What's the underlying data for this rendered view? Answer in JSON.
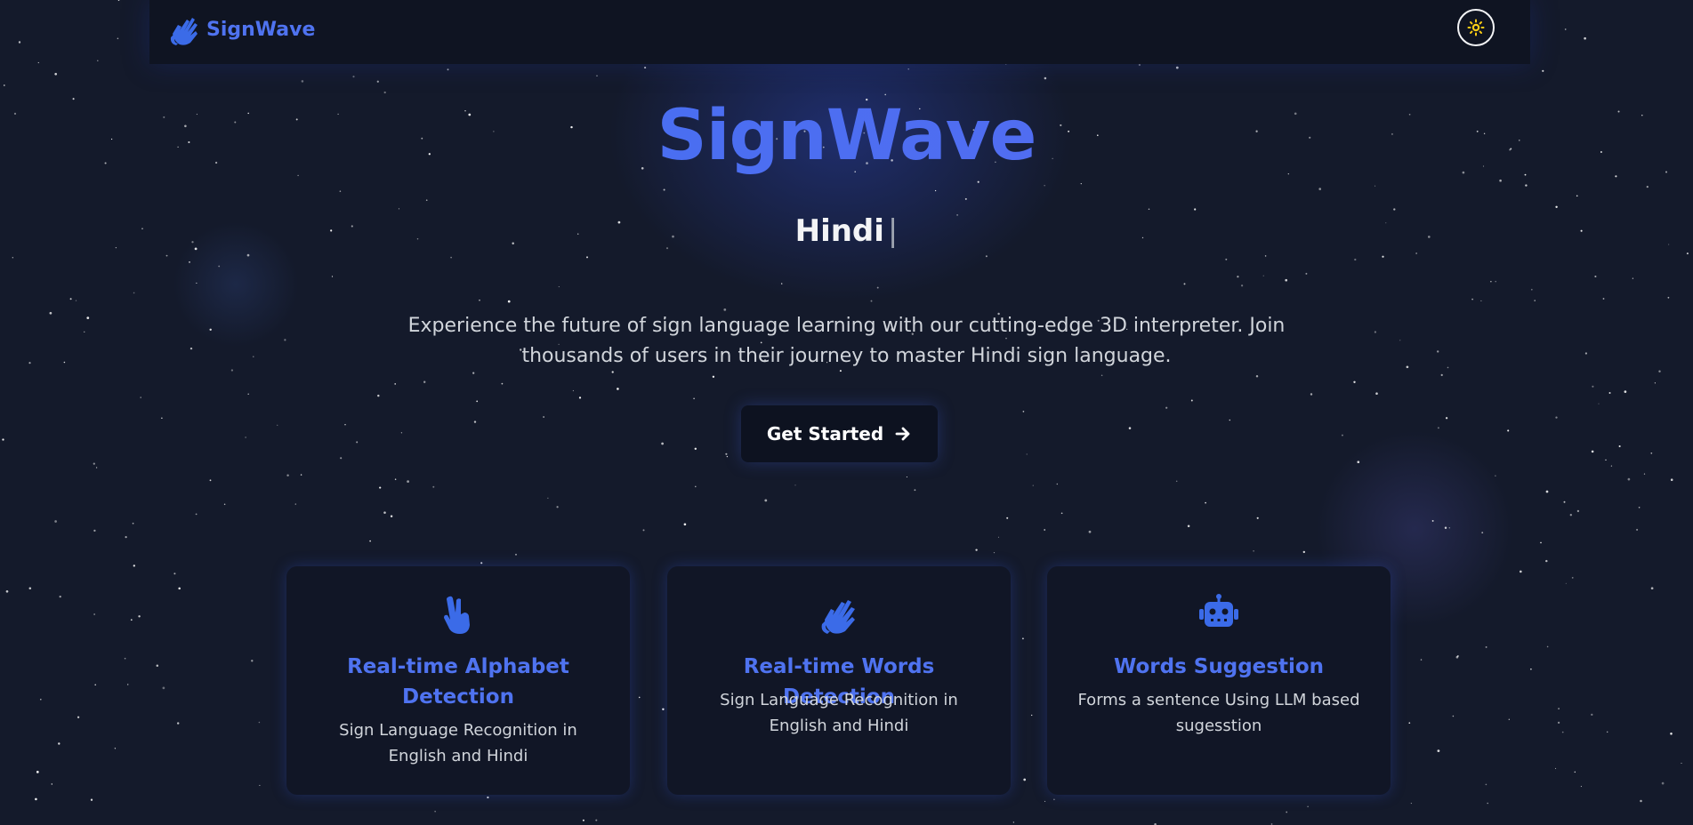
{
  "navbar": {
    "brand": "SignWave",
    "brand_icon": "sign-language-hands-icon",
    "theme_toggle_icon": "sun-icon"
  },
  "hero": {
    "title": "SignWave",
    "typed_word": "Hindi",
    "cursor": "|",
    "description": "Experience the future of sign language learning with our cutting-edge 3D interpreter. Join thousands of users in their journey to master Hindi sign language.",
    "cta_label": "Get Started",
    "cta_icon": "arrow-right-icon"
  },
  "features": [
    {
      "icon": "hand-pointing-icon",
      "title": "Real-time Alphabet Detection",
      "description": "Sign Language Recognition in English and Hindi"
    },
    {
      "icon": "sign-language-hands-icon",
      "title": "Real-time Words Detection",
      "description": "Sign Language Recognition in English and Hindi"
    },
    {
      "icon": "robot-icon",
      "title": "Words Suggestion",
      "description": "Forms a sentence Using LLM based sugesstion"
    }
  ],
  "colors": {
    "background": "#141a2b",
    "navbar": "#0f1422",
    "accent": "#4f73f0",
    "sun": "#facc15"
  }
}
